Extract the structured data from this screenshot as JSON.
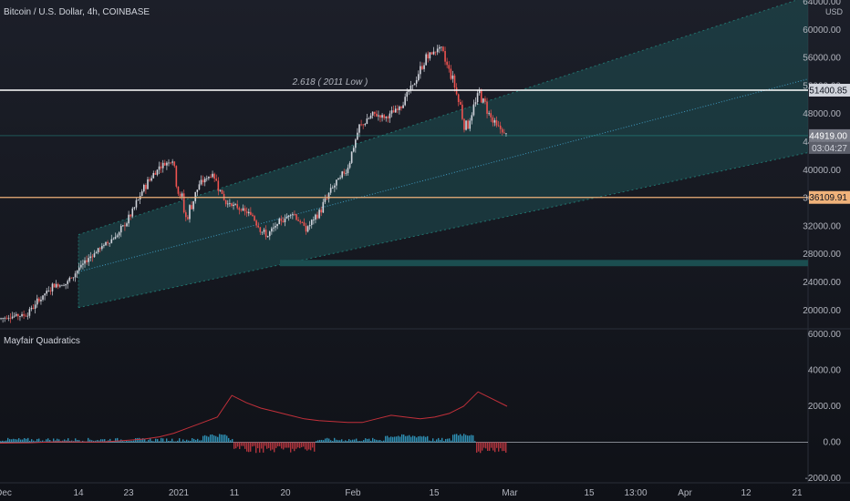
{
  "header": {
    "symbol_title": "Bitcoin / U.S. Dollar, 4h, COINBASE",
    "currency": "USD"
  },
  "indicator": {
    "name": "Mayfair Quadratics"
  },
  "colors": {
    "background": "#131722",
    "channel_fill": "#1f5a5e",
    "channel_edge": "#26a69a",
    "candle_up": "#d1d4dc",
    "candle_down": "#ef5350",
    "resistance_line": "#ffffff",
    "support_line": "#f0b27a",
    "support_tag": "#f0b27a",
    "resistance_tag": "#d1d4dc",
    "zone_fill": "#1b4e50",
    "indicator_line": "#c2303a",
    "hist_up": "#2e8fb3",
    "hist_down": "#b2343d"
  },
  "chart_data": [
    {
      "type": "candlestick",
      "title": "Bitcoin / U.S. Dollar, 4h, COINBASE",
      "ylabel": "USD",
      "ylim": [
        17500,
        64000
      ],
      "y_ticks": [
        "64000.00",
        "60000.00",
        "56000.00",
        "52000.00",
        "48000.00",
        "44000.00",
        "40000.00",
        "36000.00",
        "32000.00",
        "28000.00",
        "24000.00",
        "20000.00"
      ],
      "x_ticks": [
        "Dec",
        "14",
        "23",
        "2021",
        "11",
        "20",
        "Feb",
        "15",
        "Mar",
        "15",
        "13:00",
        "Apr",
        "12",
        "21"
      ],
      "annotations": [
        {
          "label": "2.618 ( 2011 Low )",
          "value": 51400.85,
          "tag": "51400.85"
        },
        {
          "label": "",
          "value": 36109.91,
          "tag": "36109.91"
        },
        {
          "label": "",
          "value": 44919.0,
          "tag": "44919.00",
          "countdown": "03:04:27"
        }
      ],
      "price_path": [
        [
          "Dec",
          18800
        ],
        [
          "Dec",
          19200
        ],
        [
          "14",
          19300
        ],
        [
          "14",
          21500
        ],
        [
          "14",
          23500
        ],
        [
          "23",
          23800
        ],
        [
          "23",
          26000
        ],
        [
          "23",
          28000
        ],
        [
          "23",
          29500
        ],
        [
          "2021",
          31000
        ],
        [
          "2021",
          34000
        ],
        [
          "2021",
          38000
        ],
        [
          "2021",
          40500
        ],
        [
          "2021",
          41500
        ],
        [
          "11",
          33000
        ],
        [
          "11",
          38000
        ],
        [
          "11",
          39500
        ],
        [
          "11",
          35500
        ],
        [
          "20",
          34500
        ],
        [
          "20",
          33500
        ],
        [
          "20",
          30500
        ],
        [
          "20",
          32500
        ],
        [
          "20",
          34000
        ],
        [
          "20",
          31500
        ],
        [
          "Feb",
          34000
        ],
        [
          "Feb",
          37500
        ],
        [
          "Feb",
          40000
        ],
        [
          "Feb",
          46000
        ],
        [
          "Feb",
          48000
        ],
        [
          "Feb",
          47500
        ],
        [
          "15",
          49000
        ],
        [
          "15",
          52000
        ],
        [
          "15",
          56000
        ],
        [
          "15",
          57500
        ],
        [
          "15",
          53000
        ],
        [
          "15",
          46000
        ],
        [
          "15",
          51000
        ],
        [
          "15",
          47000
        ],
        [
          "15",
          44919
        ]
      ],
      "zone": {
        "from": 26300,
        "to": 27200
      }
    },
    {
      "type": "line",
      "title": "Mayfair Quadratics",
      "ylim": [
        -2000,
        6000
      ],
      "y_ticks": [
        "6000.00",
        "4000.00",
        "2000.00",
        "0.00",
        "-2000.00"
      ],
      "series": [
        {
          "values": [
            -50,
            -40,
            -30,
            0,
            30,
            20,
            10,
            10,
            60,
            120,
            180,
            300,
            500,
            800,
            1100,
            1400,
            2600,
            2200,
            1900,
            1700,
            1500,
            1300,
            1200,
            1150,
            1100,
            1100,
            1300,
            1500,
            1400,
            1300,
            1400,
            1600,
            2000,
            2800,
            2400,
            2000
          ]
        }
      ]
    }
  ]
}
